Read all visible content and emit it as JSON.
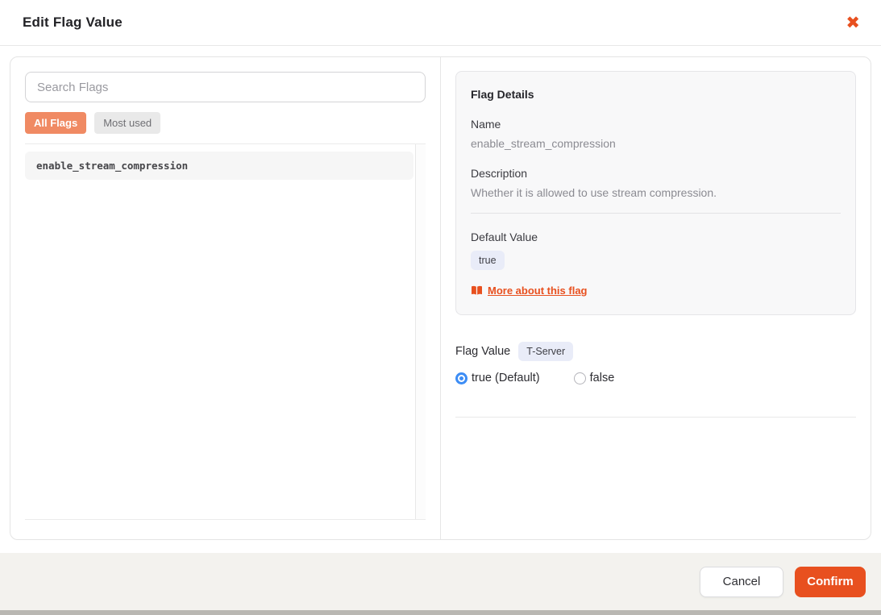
{
  "modal": {
    "title": "Edit Flag Value",
    "close_icon": "✖"
  },
  "left_panel": {
    "search_placeholder": "Search Flags",
    "tabs": [
      {
        "label": "All Flags",
        "active": true
      },
      {
        "label": "Most used",
        "active": false
      }
    ],
    "flags": [
      {
        "name": "enable_stream_compression"
      }
    ]
  },
  "flag_details": {
    "heading": "Flag Details",
    "name_label": "Name",
    "name_value": "enable_stream_compression",
    "description_label": "Description",
    "description_value": "Whether it is allowed to use stream compression.",
    "default_value_label": "Default Value",
    "default_value": "true",
    "more_link_label": "More about this flag"
  },
  "flag_value": {
    "label": "Flag Value",
    "scope_badge": "T-Server",
    "options": [
      {
        "label": "true (Default)",
        "selected": true
      },
      {
        "label": "false",
        "selected": false
      }
    ]
  },
  "footer": {
    "cancel_label": "Cancel",
    "confirm_label": "Confirm"
  },
  "colors": {
    "accent_orange": "#e8501f",
    "tab_active_bg": "#f08a63",
    "radio_blue": "#3d8df5",
    "badge_bg": "#e9ecf8",
    "footer_bg": "#f3f2ee"
  }
}
